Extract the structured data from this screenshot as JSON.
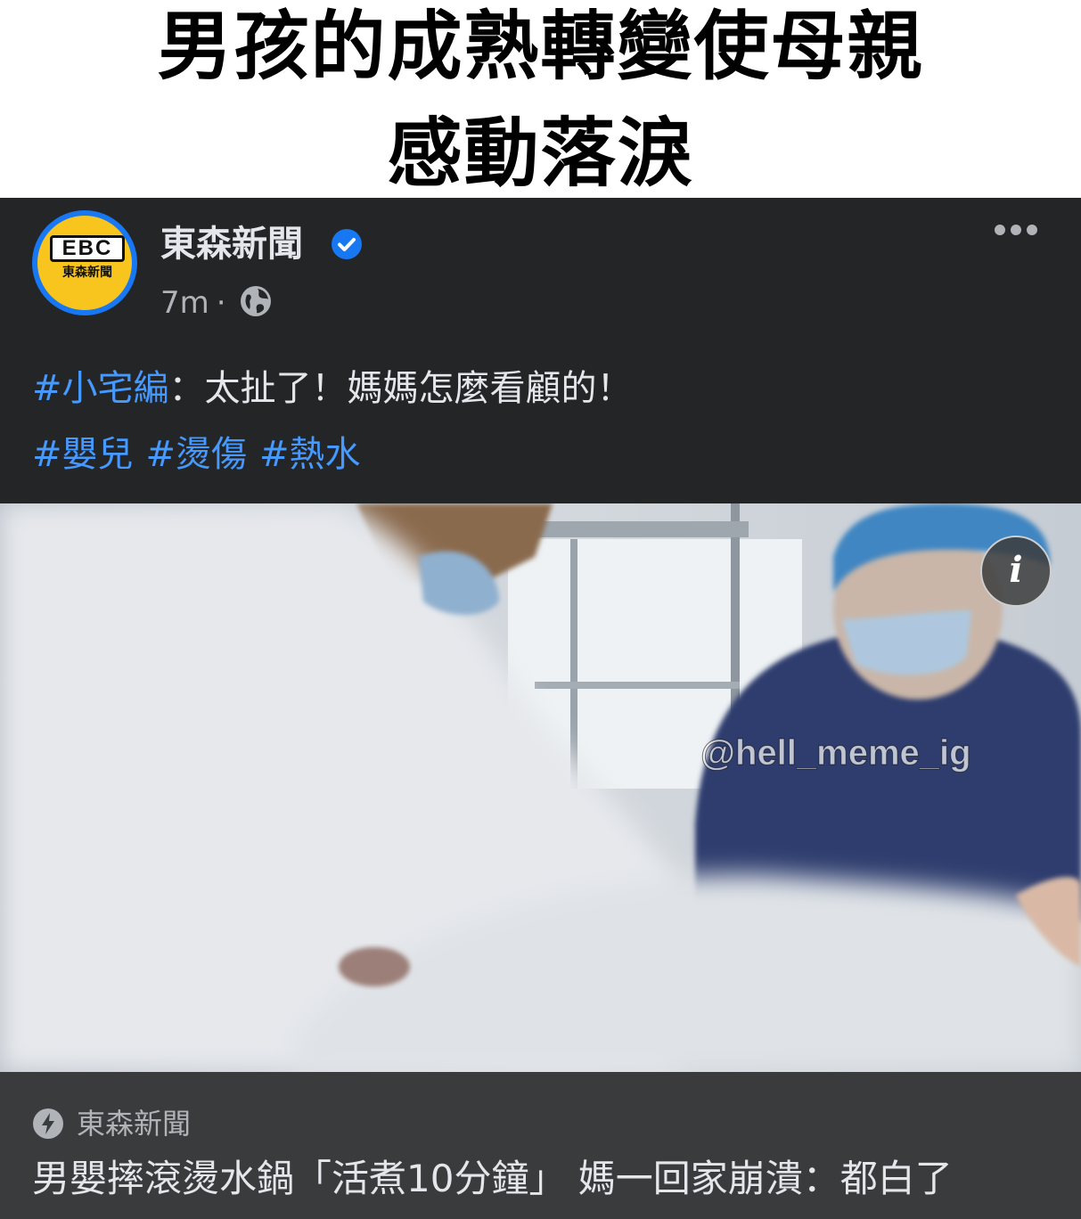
{
  "meme_caption": {
    "line1": "男孩的成熟轉變使母親",
    "line2": "感動落淚"
  },
  "post": {
    "page_name": "東森新聞",
    "avatar": {
      "logo_text": "EBC",
      "sub_text": "東森新聞"
    },
    "verified_icon": "verified-badge-icon",
    "timestamp": "7m",
    "separator": "·",
    "audience_icon": "globe-icon",
    "more_icon": "more-options-icon",
    "caption": {
      "hashtag": "#小宅編",
      "text": "：太扯了！媽媽怎麼看顧的！"
    },
    "hashtags": [
      "#嬰兒",
      "#燙傷",
      "#熱水"
    ],
    "colors": {
      "background": "#242526",
      "text": "#e4e6eb",
      "meta": "#b0b3b8",
      "hashtag": "#4599ff",
      "verified": "#1877f2"
    }
  },
  "media": {
    "info_icon": "info-icon",
    "info_label": "i",
    "watermark": "@hell_meme_ig"
  },
  "link_preview": {
    "source_icon": "instant-article-bolt-icon",
    "source": "東森新聞",
    "headline": "男嬰摔滾燙水鍋「活煮10分鐘」 媽一回家崩潰：都白了"
  }
}
